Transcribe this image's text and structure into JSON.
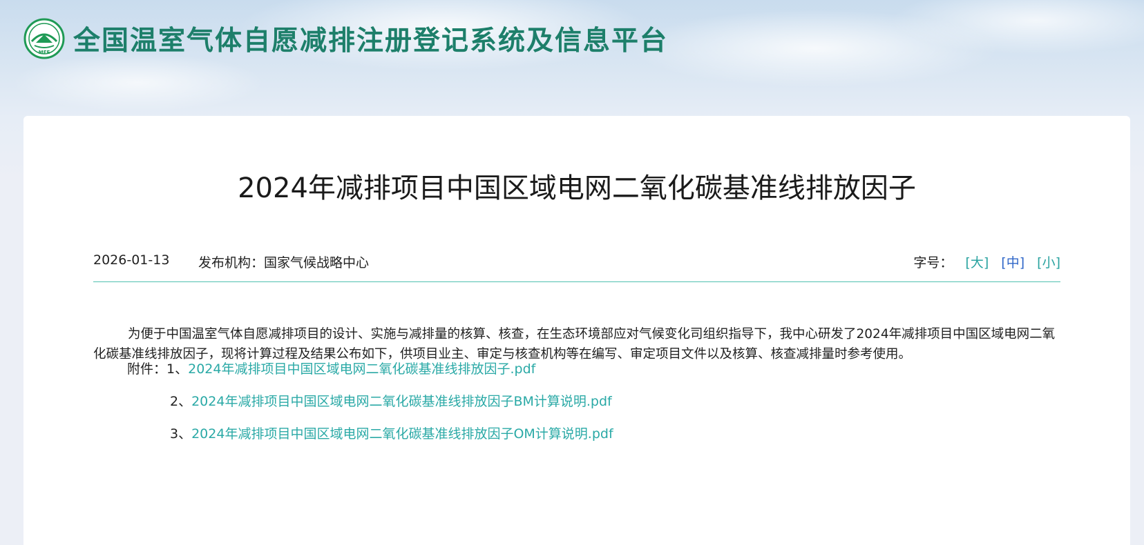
{
  "header": {
    "logo_text": "MEE",
    "site_title": "全国温室气体自愿减排注册登记系统及信息平台"
  },
  "article": {
    "title": "2024年减排项目中国区域电网二氧化碳基准线排放因子",
    "date": "2026-01-13",
    "publisher": "发布机构：国家气候战略中心",
    "font_size_label": "字号：",
    "font_size_options": [
      "[大]",
      "[中]",
      "[小]"
    ],
    "body": "为便于中国温室气体自愿减排项目的设计、实施与减排量的核算、核查，在生态环境部应对气候变化司组织指导下，我中心研发了2024年减排项目中国区域电网二氧化碳基准线排放因子，现将计算过程及结果公布如下，供项目业主、审定与核查机构等在编写、审定项目文件以及核算、核查减排量时参考使用。",
    "attachments_label": "附件：",
    "attachments": [
      {
        "index": "1、",
        "name": "2024年减排项目中国区域电网二氧化碳基准线排放因子.pdf"
      },
      {
        "index": "2、",
        "name": "2024年减排项目中国区域电网二氧化碳基准线排放因子BM计算说明.pdf"
      },
      {
        "index": "3、",
        "name": "2024年减排项目中国区域电网二氧化碳基准线排放因子OM计算说明.pdf"
      }
    ]
  },
  "colors": {
    "brand_green": "#1d7f6a",
    "link_teal": "#2aa9a6",
    "active_blue": "#2f66c8",
    "divider": "#4fc0b0"
  }
}
